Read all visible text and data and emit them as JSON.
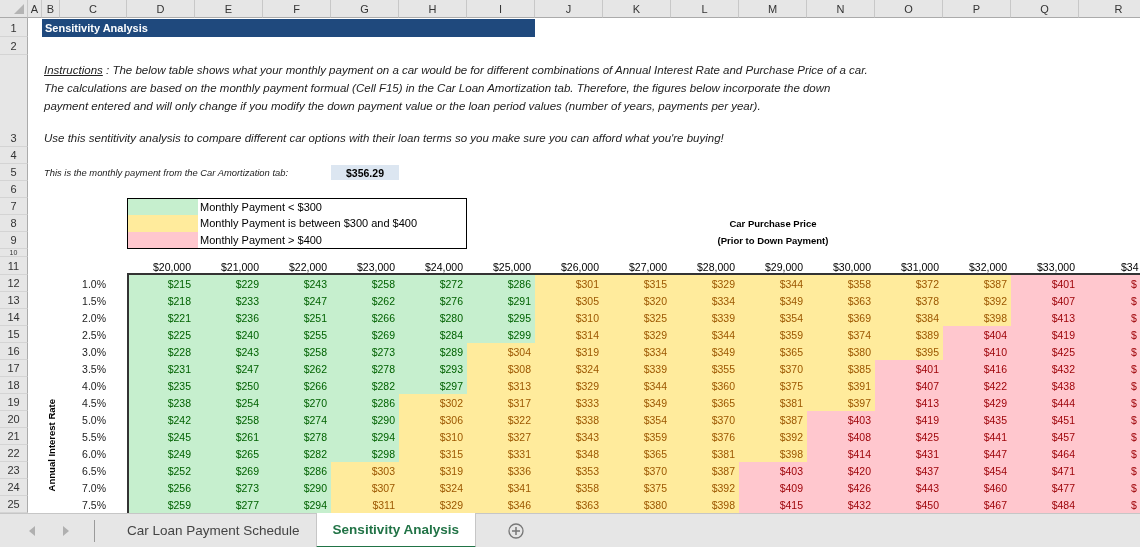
{
  "columns": [
    "A",
    "B",
    "C",
    "D",
    "E",
    "F",
    "G",
    "H",
    "I",
    "J",
    "K",
    "L",
    "M",
    "N",
    "O",
    "P",
    "Q",
    "R"
  ],
  "row_numbers": [
    "1",
    "2",
    "3",
    "4",
    "5",
    "6",
    "7",
    "8",
    "9",
    "10",
    "11",
    "12",
    "13",
    "14",
    "15",
    "16",
    "17",
    "18",
    "19",
    "20",
    "21",
    "22",
    "23",
    "24",
    "25"
  ],
  "title": "Sensitivity Analysis",
  "instructions": {
    "label": "Instructions",
    "text": " : The below table shows what your monthly payment on a car would be for different combinations of Annual Interest Rate and Purchase Price of a car. The calculations are based on the monthly payment formual (Cell F15) in the Car Loan Amortization tab. Therefore, the figures below incorporate the down payment entered and will only change if you modify the down payment value or the loan period values (number of years, payments per year).",
    "note": "Use this sentitivity analysis to compare different car options with their loan terms so you make sure you can afford what you're buying!"
  },
  "monthly_payment": {
    "label": "This is the monthly payment from the Car Amortization tab:",
    "value": "$356.29"
  },
  "legend": [
    {
      "label": "Monthly Payment < $300",
      "color": "#c6efce"
    },
    {
      "label": "Monthly Payment is between $300 and $400",
      "color": "#ffeb9c"
    },
    {
      "label": "Monthly Payment > $400",
      "color": "#ffc7ce"
    }
  ],
  "price_axis_title": [
    "Car Purchase Price",
    "(Prior to Down Payment)"
  ],
  "rate_axis_title": "Annual Interest Rate",
  "table": {
    "prices": [
      "$20,000",
      "$21,000",
      "$22,000",
      "$23,000",
      "$24,000",
      "$25,000",
      "$26,000",
      "$27,000",
      "$28,000",
      "$29,000",
      "$30,000",
      "$31,000",
      "$32,000",
      "$33,000",
      "$34"
    ],
    "rows": [
      {
        "rate": "1.0%",
        "cells": [
          {
            "text": "$215",
            "kind": "low"
          },
          {
            "text": "$229",
            "kind": "low"
          },
          {
            "text": "$243",
            "kind": "low"
          },
          {
            "text": "$258",
            "kind": "low"
          },
          {
            "text": "$272",
            "kind": "low"
          },
          {
            "text": "$286",
            "kind": "low"
          },
          {
            "text": "$301",
            "kind": "mid"
          },
          {
            "text": "$315",
            "kind": "mid"
          },
          {
            "text": "$329",
            "kind": "mid"
          },
          {
            "text": "$344",
            "kind": "mid"
          },
          {
            "text": "$358",
            "kind": "mid"
          },
          {
            "text": "$372",
            "kind": "mid"
          },
          {
            "text": "$387",
            "kind": "mid"
          },
          {
            "text": "$401",
            "kind": "high"
          },
          {
            "text": "$",
            "kind": "high"
          }
        ]
      },
      {
        "rate": "1.5%",
        "cells": [
          {
            "text": "$218",
            "kind": "low"
          },
          {
            "text": "$233",
            "kind": "low"
          },
          {
            "text": "$247",
            "kind": "low"
          },
          {
            "text": "$262",
            "kind": "low"
          },
          {
            "text": "$276",
            "kind": "low"
          },
          {
            "text": "$291",
            "kind": "low"
          },
          {
            "text": "$305",
            "kind": "mid"
          },
          {
            "text": "$320",
            "kind": "mid"
          },
          {
            "text": "$334",
            "kind": "mid"
          },
          {
            "text": "$349",
            "kind": "mid"
          },
          {
            "text": "$363",
            "kind": "mid"
          },
          {
            "text": "$378",
            "kind": "mid"
          },
          {
            "text": "$392",
            "kind": "mid"
          },
          {
            "text": "$407",
            "kind": "high"
          },
          {
            "text": "$",
            "kind": "high"
          }
        ]
      },
      {
        "rate": "2.0%",
        "cells": [
          {
            "text": "$221",
            "kind": "low"
          },
          {
            "text": "$236",
            "kind": "low"
          },
          {
            "text": "$251",
            "kind": "low"
          },
          {
            "text": "$266",
            "kind": "low"
          },
          {
            "text": "$280",
            "kind": "low"
          },
          {
            "text": "$295",
            "kind": "low"
          },
          {
            "text": "$310",
            "kind": "mid"
          },
          {
            "text": "$325",
            "kind": "mid"
          },
          {
            "text": "$339",
            "kind": "mid"
          },
          {
            "text": "$354",
            "kind": "mid"
          },
          {
            "text": "$369",
            "kind": "mid"
          },
          {
            "text": "$384",
            "kind": "mid"
          },
          {
            "text": "$398",
            "kind": "mid"
          },
          {
            "text": "$413",
            "kind": "high"
          },
          {
            "text": "$",
            "kind": "high"
          }
        ]
      },
      {
        "rate": "2.5%",
        "cells": [
          {
            "text": "$225",
            "kind": "low"
          },
          {
            "text": "$240",
            "kind": "low"
          },
          {
            "text": "$255",
            "kind": "low"
          },
          {
            "text": "$269",
            "kind": "low"
          },
          {
            "text": "$284",
            "kind": "low"
          },
          {
            "text": "$299",
            "kind": "low"
          },
          {
            "text": "$314",
            "kind": "mid"
          },
          {
            "text": "$329",
            "kind": "mid"
          },
          {
            "text": "$344",
            "kind": "mid"
          },
          {
            "text": "$359",
            "kind": "mid"
          },
          {
            "text": "$374",
            "kind": "mid"
          },
          {
            "text": "$389",
            "kind": "mid"
          },
          {
            "text": "$404",
            "kind": "high"
          },
          {
            "text": "$419",
            "kind": "high"
          },
          {
            "text": "$",
            "kind": "high"
          }
        ]
      },
      {
        "rate": "3.0%",
        "cells": [
          {
            "text": "$228",
            "kind": "low"
          },
          {
            "text": "$243",
            "kind": "low"
          },
          {
            "text": "$258",
            "kind": "low"
          },
          {
            "text": "$273",
            "kind": "low"
          },
          {
            "text": "$289",
            "kind": "low"
          },
          {
            "text": "$304",
            "kind": "mid"
          },
          {
            "text": "$319",
            "kind": "mid"
          },
          {
            "text": "$334",
            "kind": "mid"
          },
          {
            "text": "$349",
            "kind": "mid"
          },
          {
            "text": "$365",
            "kind": "mid"
          },
          {
            "text": "$380",
            "kind": "mid"
          },
          {
            "text": "$395",
            "kind": "mid"
          },
          {
            "text": "$410",
            "kind": "high"
          },
          {
            "text": "$425",
            "kind": "high"
          },
          {
            "text": "$",
            "kind": "high"
          }
        ]
      },
      {
        "rate": "3.5%",
        "cells": [
          {
            "text": "$231",
            "kind": "low"
          },
          {
            "text": "$247",
            "kind": "low"
          },
          {
            "text": "$262",
            "kind": "low"
          },
          {
            "text": "$278",
            "kind": "low"
          },
          {
            "text": "$293",
            "kind": "low"
          },
          {
            "text": "$308",
            "kind": "mid"
          },
          {
            "text": "$324",
            "kind": "mid"
          },
          {
            "text": "$339",
            "kind": "mid"
          },
          {
            "text": "$355",
            "kind": "mid"
          },
          {
            "text": "$370",
            "kind": "mid"
          },
          {
            "text": "$385",
            "kind": "mid"
          },
          {
            "text": "$401",
            "kind": "high"
          },
          {
            "text": "$416",
            "kind": "high"
          },
          {
            "text": "$432",
            "kind": "high"
          },
          {
            "text": "$",
            "kind": "high"
          }
        ]
      },
      {
        "rate": "4.0%",
        "cells": [
          {
            "text": "$235",
            "kind": "low"
          },
          {
            "text": "$250",
            "kind": "low"
          },
          {
            "text": "$266",
            "kind": "low"
          },
          {
            "text": "$282",
            "kind": "low"
          },
          {
            "text": "$297",
            "kind": "low"
          },
          {
            "text": "$313",
            "kind": "mid"
          },
          {
            "text": "$329",
            "kind": "mid"
          },
          {
            "text": "$344",
            "kind": "mid"
          },
          {
            "text": "$360",
            "kind": "mid"
          },
          {
            "text": "$375",
            "kind": "mid"
          },
          {
            "text": "$391",
            "kind": "mid"
          },
          {
            "text": "$407",
            "kind": "high"
          },
          {
            "text": "$422",
            "kind": "high"
          },
          {
            "text": "$438",
            "kind": "high"
          },
          {
            "text": "$",
            "kind": "high"
          }
        ]
      },
      {
        "rate": "4.5%",
        "cells": [
          {
            "text": "$238",
            "kind": "low"
          },
          {
            "text": "$254",
            "kind": "low"
          },
          {
            "text": "$270",
            "kind": "low"
          },
          {
            "text": "$286",
            "kind": "low"
          },
          {
            "text": "$302",
            "kind": "mid"
          },
          {
            "text": "$317",
            "kind": "mid"
          },
          {
            "text": "$333",
            "kind": "mid"
          },
          {
            "text": "$349",
            "kind": "mid"
          },
          {
            "text": "$365",
            "kind": "mid"
          },
          {
            "text": "$381",
            "kind": "mid"
          },
          {
            "text": "$397",
            "kind": "mid"
          },
          {
            "text": "$413",
            "kind": "high"
          },
          {
            "text": "$429",
            "kind": "high"
          },
          {
            "text": "$444",
            "kind": "high"
          },
          {
            "text": "$",
            "kind": "high"
          }
        ]
      },
      {
        "rate": "5.0%",
        "cells": [
          {
            "text": "$242",
            "kind": "low"
          },
          {
            "text": "$258",
            "kind": "low"
          },
          {
            "text": "$274",
            "kind": "low"
          },
          {
            "text": "$290",
            "kind": "low"
          },
          {
            "text": "$306",
            "kind": "mid"
          },
          {
            "text": "$322",
            "kind": "mid"
          },
          {
            "text": "$338",
            "kind": "mid"
          },
          {
            "text": "$354",
            "kind": "mid"
          },
          {
            "text": "$370",
            "kind": "mid"
          },
          {
            "text": "$387",
            "kind": "mid"
          },
          {
            "text": "$403",
            "kind": "high"
          },
          {
            "text": "$419",
            "kind": "high"
          },
          {
            "text": "$435",
            "kind": "high"
          },
          {
            "text": "$451",
            "kind": "high"
          },
          {
            "text": "$",
            "kind": "high"
          }
        ]
      },
      {
        "rate": "5.5%",
        "cells": [
          {
            "text": "$245",
            "kind": "low"
          },
          {
            "text": "$261",
            "kind": "low"
          },
          {
            "text": "$278",
            "kind": "low"
          },
          {
            "text": "$294",
            "kind": "low"
          },
          {
            "text": "$310",
            "kind": "mid"
          },
          {
            "text": "$327",
            "kind": "mid"
          },
          {
            "text": "$343",
            "kind": "mid"
          },
          {
            "text": "$359",
            "kind": "mid"
          },
          {
            "text": "$376",
            "kind": "mid"
          },
          {
            "text": "$392",
            "kind": "mid"
          },
          {
            "text": "$408",
            "kind": "high"
          },
          {
            "text": "$425",
            "kind": "high"
          },
          {
            "text": "$441",
            "kind": "high"
          },
          {
            "text": "$457",
            "kind": "high"
          },
          {
            "text": "$",
            "kind": "high"
          }
        ]
      },
      {
        "rate": "6.0%",
        "cells": [
          {
            "text": "$249",
            "kind": "low"
          },
          {
            "text": "$265",
            "kind": "low"
          },
          {
            "text": "$282",
            "kind": "low"
          },
          {
            "text": "$298",
            "kind": "low"
          },
          {
            "text": "$315",
            "kind": "mid"
          },
          {
            "text": "$331",
            "kind": "mid"
          },
          {
            "text": "$348",
            "kind": "mid"
          },
          {
            "text": "$365",
            "kind": "mid"
          },
          {
            "text": "$381",
            "kind": "mid"
          },
          {
            "text": "$398",
            "kind": "mid"
          },
          {
            "text": "$414",
            "kind": "high"
          },
          {
            "text": "$431",
            "kind": "high"
          },
          {
            "text": "$447",
            "kind": "high"
          },
          {
            "text": "$464",
            "kind": "high"
          },
          {
            "text": "$",
            "kind": "high"
          }
        ]
      },
      {
        "rate": "6.5%",
        "cells": [
          {
            "text": "$252",
            "kind": "low"
          },
          {
            "text": "$269",
            "kind": "low"
          },
          {
            "text": "$286",
            "kind": "low"
          },
          {
            "text": "$303",
            "kind": "mid"
          },
          {
            "text": "$319",
            "kind": "mid"
          },
          {
            "text": "$336",
            "kind": "mid"
          },
          {
            "text": "$353",
            "kind": "mid"
          },
          {
            "text": "$370",
            "kind": "mid"
          },
          {
            "text": "$387",
            "kind": "mid"
          },
          {
            "text": "$403",
            "kind": "high"
          },
          {
            "text": "$420",
            "kind": "high"
          },
          {
            "text": "$437",
            "kind": "high"
          },
          {
            "text": "$454",
            "kind": "high"
          },
          {
            "text": "$471",
            "kind": "high"
          },
          {
            "text": "$",
            "kind": "high"
          }
        ]
      },
      {
        "rate": "7.0%",
        "cells": [
          {
            "text": "$256",
            "kind": "low"
          },
          {
            "text": "$273",
            "kind": "low"
          },
          {
            "text": "$290",
            "kind": "low"
          },
          {
            "text": "$307",
            "kind": "mid"
          },
          {
            "text": "$324",
            "kind": "mid"
          },
          {
            "text": "$341",
            "kind": "mid"
          },
          {
            "text": "$358",
            "kind": "mid"
          },
          {
            "text": "$375",
            "kind": "mid"
          },
          {
            "text": "$392",
            "kind": "mid"
          },
          {
            "text": "$409",
            "kind": "high"
          },
          {
            "text": "$426",
            "kind": "high"
          },
          {
            "text": "$443",
            "kind": "high"
          },
          {
            "text": "$460",
            "kind": "high"
          },
          {
            "text": "$477",
            "kind": "high"
          },
          {
            "text": "$",
            "kind": "high"
          }
        ]
      },
      {
        "rate": "7.5%",
        "cells": [
          {
            "text": "$259",
            "kind": "low"
          },
          {
            "text": "$277",
            "kind": "low"
          },
          {
            "text": "$294",
            "kind": "low"
          },
          {
            "text": "$311",
            "kind": "mid"
          },
          {
            "text": "$329",
            "kind": "mid"
          },
          {
            "text": "$346",
            "kind": "mid"
          },
          {
            "text": "$363",
            "kind": "mid"
          },
          {
            "text": "$380",
            "kind": "mid"
          },
          {
            "text": "$398",
            "kind": "mid"
          },
          {
            "text": "$415",
            "kind": "high"
          },
          {
            "text": "$432",
            "kind": "high"
          },
          {
            "text": "$450",
            "kind": "high"
          },
          {
            "text": "$467",
            "kind": "high"
          },
          {
            "text": "$484",
            "kind": "high"
          },
          {
            "text": "$",
            "kind": "high"
          }
        ]
      }
    ]
  },
  "sheet_tabs": [
    {
      "label": "Car Loan Payment Schedule",
      "selected": false
    },
    {
      "label": "Sensitivity Analysis",
      "selected": true
    }
  ]
}
